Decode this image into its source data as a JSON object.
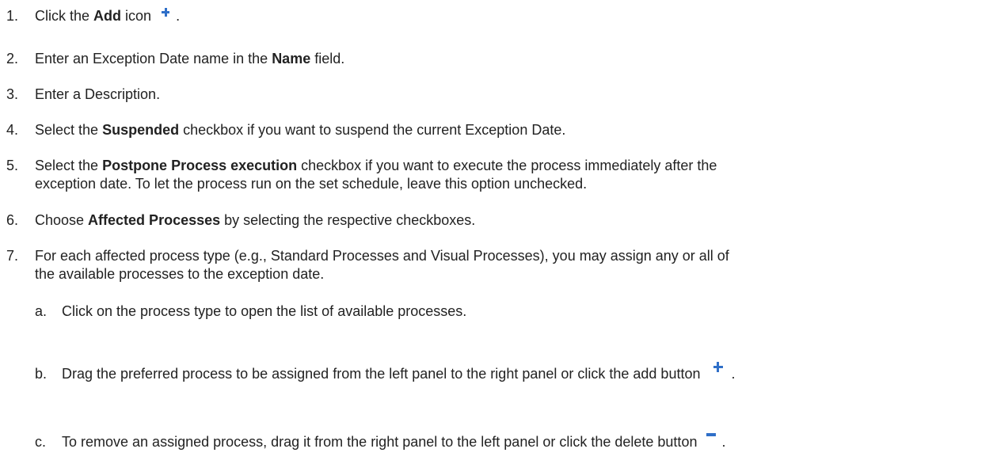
{
  "steps": [
    {
      "num": "1.",
      "t1": "Click the ",
      "b1": "Add",
      "t2": " icon",
      "t3": "."
    },
    {
      "num": "2.",
      "t1": "Enter an Exception Date name in the ",
      "b1": "Name",
      "t2": " field."
    },
    {
      "num": "3.",
      "t1": "Enter a Description."
    },
    {
      "num": "4.",
      "t1": "Select the ",
      "b1": "Suspended",
      "t2": " checkbox if you want to suspend the current Exception Date."
    },
    {
      "num": "5.",
      "t1": "Select the ",
      "b1": "Postpone Process execution",
      "t2": " checkbox if you want to execute the process immediately after the",
      "line2": "exception date. To let the process run on the set schedule, leave this option unchecked."
    },
    {
      "num": "6.",
      "t1": "Choose ",
      "b1": "Affected Processes",
      "t2": " by selecting the respective checkboxes."
    },
    {
      "num": "7.",
      "t1": "For each affected process type (e.g., Standard Processes and Visual Processes), you may assign any or all of",
      "line2": "the available processes to the exception date."
    }
  ],
  "substeps": [
    {
      "num": "a.",
      "t1": "Click on the process type to open the list of available processes."
    },
    {
      "num": "b.",
      "t1": "Drag the preferred process to be assigned from the left panel to the right panel or click the add button",
      "t2": "."
    },
    {
      "num": "c.",
      "t1": "To remove an assigned process, drag it from the right panel to the left panel or click the delete button",
      "t2": "."
    }
  ],
  "icons": {
    "add": "plus-icon",
    "delete": "minus-icon",
    "color": "#2f6fc8"
  }
}
